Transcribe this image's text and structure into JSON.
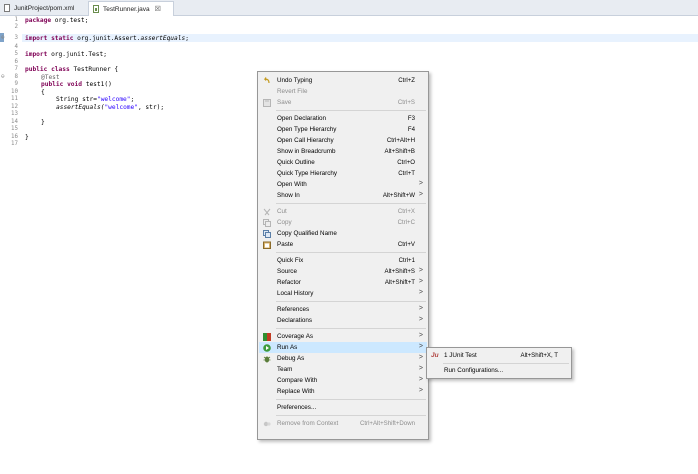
{
  "tabs": [
    {
      "label": "JunitProject/pom.xml"
    },
    {
      "label": "TestRunner.java",
      "close": "☒"
    }
  ],
  "editor": {
    "line_numbers": [
      "1",
      "2",
      "3",
      "4",
      "5",
      "6",
      "7",
      "8",
      "9",
      "10",
      "11",
      "12",
      "13",
      "14",
      "15",
      "16",
      "17"
    ],
    "lines": {
      "l1_kw": "package",
      "l1_rest": " org.test;",
      "l3_kw1": "import",
      "l3_kw2": " static",
      "l3_mid": " org.junit.Assert.",
      "l3_it": "assertEquals",
      "l3_end": ";",
      "l5_kw": "import",
      "l5_rest": " org.junit.Test;",
      "l7_kw1": "public",
      "l7_kw2": " class",
      "l7_rest": " TestRunner {",
      "l8_ann": "@Test",
      "l9_kw1": "public",
      "l9_kw2": " void",
      "l9_rest": " test1()",
      "l10": "{",
      "l11_a": "String str=",
      "l11_str": "\"welcome\"",
      "l11_b": ";",
      "l12_a": "assertEquals(",
      "l12_str": "\"welcome\"",
      "l12_b": ", str);",
      "l14": "}",
      "l16": "}"
    }
  },
  "context_menu": {
    "undo_typing": {
      "label": "Undo Typing",
      "shortcut": "Ctrl+Z"
    },
    "revert_file": {
      "label": "Revert File"
    },
    "save": {
      "label": "Save",
      "shortcut": "Ctrl+S"
    },
    "open_declaration": {
      "label": "Open Declaration",
      "shortcut": "F3"
    },
    "open_type_hierarchy": {
      "label": "Open Type Hierarchy",
      "shortcut": "F4"
    },
    "open_call_hierarchy": {
      "label": "Open Call Hierarchy",
      "shortcut": "Ctrl+Alt+H"
    },
    "show_in_breadcrumb": {
      "label": "Show in Breadcrumb",
      "shortcut": "Alt+Shift+B"
    },
    "quick_outline": {
      "label": "Quick Outline",
      "shortcut": "Ctrl+O"
    },
    "quick_type_hierarchy": {
      "label": "Quick Type Hierarchy",
      "shortcut": "Ctrl+T"
    },
    "open_with": {
      "label": "Open With"
    },
    "show_in": {
      "label": "Show In",
      "shortcut": "Alt+Shift+W"
    },
    "cut": {
      "label": "Cut",
      "shortcut": "Ctrl+X"
    },
    "copy": {
      "label": "Copy",
      "shortcut": "Ctrl+C"
    },
    "copy_qualified_name": {
      "label": "Copy Qualified Name"
    },
    "paste": {
      "label": "Paste",
      "shortcut": "Ctrl+V"
    },
    "quick_fix": {
      "label": "Quick Fix",
      "shortcut": "Ctrl+1"
    },
    "source": {
      "label": "Source",
      "shortcut": "Alt+Shift+S"
    },
    "refactor": {
      "label": "Refactor",
      "shortcut": "Alt+Shift+T"
    },
    "local_history": {
      "label": "Local History"
    },
    "references": {
      "label": "References"
    },
    "declarations": {
      "label": "Declarations"
    },
    "coverage_as": {
      "label": "Coverage As"
    },
    "run_as": {
      "label": "Run As"
    },
    "debug_as": {
      "label": "Debug As"
    },
    "team": {
      "label": "Team"
    },
    "compare_with": {
      "label": "Compare With"
    },
    "replace_with": {
      "label": "Replace With"
    },
    "preferences": {
      "label": "Preferences..."
    },
    "remove_from_context": {
      "label": "Remove from Context",
      "shortcut": "Ctrl+Alt+Shift+Down"
    },
    "arrow": ">"
  },
  "submenu": {
    "junit_test": {
      "icon_text": "Ju",
      "label": "1 JUnit Test",
      "shortcut": "Alt+Shift+X, T"
    },
    "run_configurations": {
      "label": "Run Configurations..."
    }
  },
  "colors": {
    "highlight": "#cce8ff",
    "keyword": "#7f0055",
    "string": "#2a00ff",
    "menu_bg": "#f0f0f0"
  }
}
